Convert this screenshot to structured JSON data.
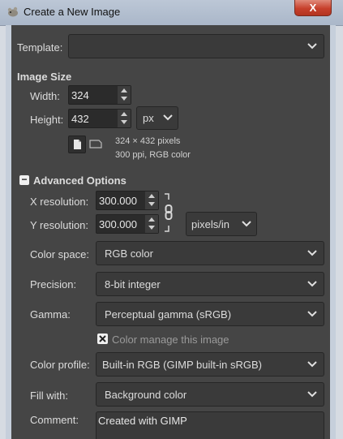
{
  "window": {
    "title": "Create a New Image",
    "close_symbol": "X"
  },
  "template": {
    "label": "Template:",
    "value": ""
  },
  "image_size": {
    "heading": "Image Size",
    "width_label": "Width:",
    "width_value": "324",
    "height_label": "Height:",
    "height_value": "432",
    "unit": "px",
    "info_line1": "324 × 432 pixels",
    "info_line2": "300 ppi, RGB color"
  },
  "advanced": {
    "toggle_symbol": "−",
    "heading": "Advanced Options",
    "x_res_label": "X resolution:",
    "x_res_value": "300.000",
    "y_res_label": "Y resolution:",
    "y_res_value": "300.000",
    "res_unit": "pixels/in",
    "color_space_label": "Color space:",
    "color_space_value": "RGB color",
    "precision_label": "Precision:",
    "precision_value": "8-bit integer",
    "gamma_label": "Gamma:",
    "gamma_value": "Perceptual gamma (sRGB)",
    "color_manage_label": "Color manage this image",
    "color_manage_checked": true,
    "color_profile_label": "Color profile:",
    "color_profile_value": "Built-in RGB (GIMP built-in sRGB)",
    "fill_label": "Fill with:",
    "fill_value": "Background color",
    "comment_label": "Comment:",
    "comment_value": "Created with GIMP"
  },
  "icons": {
    "app": "gimp-wilber-icon",
    "portrait": "portrait-orientation-icon",
    "landscape": "landscape-orientation-icon",
    "chain": "chain-link-icon",
    "chevron": "chevron-down-icon",
    "checkbox": "checkbox-icon"
  },
  "colors": {
    "dialog_bg": "#454545",
    "field_bg": "#3a3a3a",
    "frame": "#c6cfdb"
  }
}
